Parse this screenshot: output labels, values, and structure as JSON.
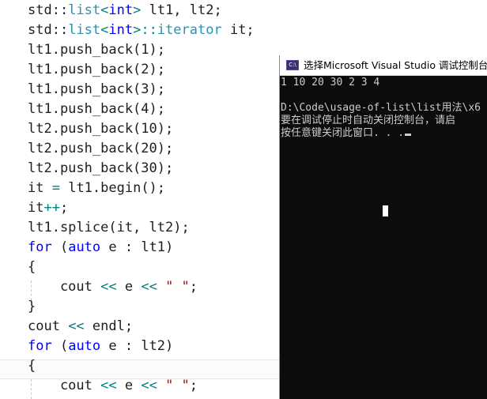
{
  "code_lines": [
    [
      {
        "t": "std::",
        "c": "t-plain"
      },
      {
        "t": "list",
        "c": "t-type"
      },
      {
        "t": "<",
        "c": "t-op"
      },
      {
        "t": "int",
        "c": "t-kw"
      },
      {
        "t": ">",
        "c": "t-op"
      },
      {
        "t": " lt1, lt2;",
        "c": "t-plain"
      }
    ],
    [
      {
        "t": "std::",
        "c": "t-plain"
      },
      {
        "t": "list",
        "c": "t-type"
      },
      {
        "t": "<",
        "c": "t-op"
      },
      {
        "t": "int",
        "c": "t-kw"
      },
      {
        "t": ">::",
        "c": "t-op"
      },
      {
        "t": "iterator",
        "c": "t-type"
      },
      {
        "t": " it;",
        "c": "t-plain"
      }
    ],
    [
      {
        "t": "lt1.push_back(1);",
        "c": "t-plain"
      }
    ],
    [
      {
        "t": "lt1.push_back(2);",
        "c": "t-plain"
      }
    ],
    [
      {
        "t": "lt1.push_back(3);",
        "c": "t-plain"
      }
    ],
    [
      {
        "t": "lt1.push_back(4);",
        "c": "t-plain"
      }
    ],
    [
      {
        "t": "lt2.push_back(10);",
        "c": "t-plain"
      }
    ],
    [
      {
        "t": "lt2.push_back(20);",
        "c": "t-plain"
      }
    ],
    [
      {
        "t": "lt2.push_back(30);",
        "c": "t-plain"
      }
    ],
    [
      {
        "t": "it ",
        "c": "t-plain"
      },
      {
        "t": "=",
        "c": "t-op"
      },
      {
        "t": " lt1.begin();",
        "c": "t-plain"
      }
    ],
    [
      {
        "t": "it",
        "c": "t-plain"
      },
      {
        "t": "++",
        "c": "t-op"
      },
      {
        "t": ";",
        "c": "t-plain"
      }
    ],
    [
      {
        "t": "lt1.splice(it, lt2);",
        "c": "t-plain"
      }
    ],
    [
      {
        "t": "for",
        "c": "t-kw"
      },
      {
        "t": " (",
        "c": "t-plain"
      },
      {
        "t": "auto",
        "c": "t-kw"
      },
      {
        "t": " e : lt1)",
        "c": "t-plain"
      }
    ],
    [
      {
        "t": "{",
        "c": "t-plain"
      }
    ],
    [
      {
        "t": "    cout ",
        "c": "t-plain"
      },
      {
        "t": "<<",
        "c": "t-op"
      },
      {
        "t": " e ",
        "c": "t-plain"
      },
      {
        "t": "<<",
        "c": "t-op"
      },
      {
        "t": " ",
        "c": "t-plain"
      },
      {
        "t": "\" \"",
        "c": "t-str"
      },
      {
        "t": ";",
        "c": "t-plain"
      }
    ],
    [
      {
        "t": "}",
        "c": "t-plain"
      }
    ],
    [
      {
        "t": "cout ",
        "c": "t-plain"
      },
      {
        "t": "<<",
        "c": "t-op"
      },
      {
        "t": " endl;",
        "c": "t-plain"
      }
    ],
    [
      {
        "t": "for",
        "c": "t-kw"
      },
      {
        "t": " (",
        "c": "t-plain"
      },
      {
        "t": "auto",
        "c": "t-kw"
      },
      {
        "t": " e : lt2)",
        "c": "t-plain"
      }
    ],
    [
      {
        "t": "{",
        "c": "t-plain"
      }
    ],
    [
      {
        "t": "    cout ",
        "c": "t-plain"
      },
      {
        "t": "<<",
        "c": "t-op"
      },
      {
        "t": " e ",
        "c": "t-plain"
      },
      {
        "t": "<<",
        "c": "t-op"
      },
      {
        "t": " ",
        "c": "t-plain"
      },
      {
        "t": "\" \"",
        "c": "t-str"
      },
      {
        "t": ";",
        "c": "t-plain"
      }
    ]
  ],
  "console": {
    "title": "选择Microsoft Visual Studio 调试控制台",
    "icon_text": "C:\\",
    "output_line": "1 10 20 30 2 3 4",
    "path_line": "D:\\Code\\usage-of-list\\list用法\\x6",
    "message_line_1": "要在调试停止时自动关闭控制台，请启",
    "message_line_2": "按任意键关闭此窗口. . ."
  },
  "colors": {
    "keyword": "#0000ff",
    "type": "#2b91af",
    "string": "#a31515",
    "operator": "#008080",
    "console_bg": "#0c0c0c",
    "console_text": "#cccccc"
  }
}
